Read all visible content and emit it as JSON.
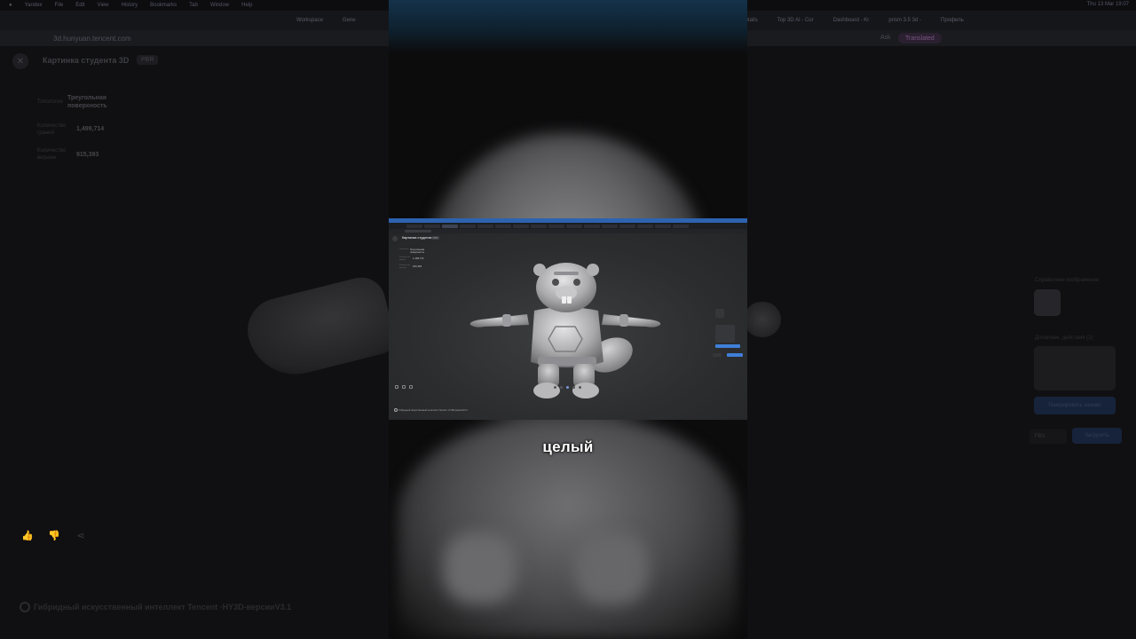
{
  "menubar": {
    "app": "Yandex",
    "items": [
      "File",
      "Edit",
      "View",
      "History",
      "Bookmarks",
      "Tab",
      "Window",
      "Help"
    ],
    "clock": "Thu 13 Mar 19:07"
  },
  "browser": {
    "tabs": [
      "Workspace",
      "Gene",
      "Asset Details",
      "Top 3D AI - Cor",
      "Dashboard - Kr",
      "prism 3.5 3d -",
      "Профиль"
    ],
    "url": "3d.hunyuan.tencent.com",
    "ask_label": "Ask",
    "translated_label": "Translated"
  },
  "page": {
    "title": "Картинка студента 3D",
    "badge": "PBR",
    "stats": [
      {
        "label": "Топология",
        "value": "Треугольная поверхность"
      },
      {
        "label": "Количество граней",
        "value": "1,499,714"
      },
      {
        "label": "Количество вершин",
        "value": "915,393"
      }
    ],
    "side_panel": {
      "reference_title": "Справочное изображение",
      "generated_title": "Дополнен. действия (2)",
      "regenerate_button": "Генерировать заново",
      "format": "FBX",
      "download_button": "Загрузить"
    },
    "footer": "Гибридный искусственный интеллект Tencent ·HY3D-версииV3.1"
  },
  "inner": {
    "title": "Картинка студента 3D",
    "badge": "PBR",
    "stats": [
      {
        "label": "Топология",
        "value": "Треугольная поверхность"
      },
      {
        "label": "Количество граней",
        "value": "1,499,714"
      },
      {
        "label": "Количество вершин",
        "value": "915,393"
      }
    ],
    "footer": "Гибридный искусственный интеллект Tencent ·HY3D-версииV3.1"
  },
  "subtitle": "целый",
  "colors": {
    "accent": "#3f7fd9",
    "background": "#101012"
  }
}
